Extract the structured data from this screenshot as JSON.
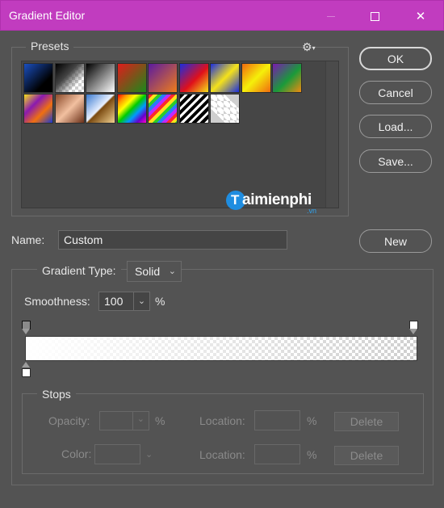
{
  "window": {
    "title": "Gradient Editor",
    "controls": {
      "minimize": "–",
      "maximize": "☐",
      "close": "✕"
    }
  },
  "presets": {
    "label": "Presets",
    "gear_icon": "⚙",
    "gear_caret": "▾",
    "swatches": [
      {
        "name": "foreground-to-background",
        "css": "linear-gradient(135deg,#1a4fbf 0%,#000 70%)"
      },
      {
        "name": "foreground-to-transparent",
        "css": "linear-gradient(135deg,#000 0%,#444 40%,transparent 75%)",
        "checker": true
      },
      {
        "name": "black-white",
        "css": "linear-gradient(135deg,#000 0%,#fff 100%)"
      },
      {
        "name": "red-green",
        "css": "linear-gradient(135deg,#e11b1b 0%,#1a8a1a 100%)"
      },
      {
        "name": "violet-orange",
        "css": "linear-gradient(135deg,#5a1aa0 0%,#ef7d1a 100%)"
      },
      {
        "name": "blue-red-yellow",
        "css": "linear-gradient(135deg,#1a2de0 0%,#e0101a 55%,#f5e21a 100%)"
      },
      {
        "name": "blue-yellow-blue",
        "css": "linear-gradient(135deg,#1a2de0 0%,#f5e21a 50%,#1a2de0 100%)"
      },
      {
        "name": "orange-yellow-orange",
        "css": "linear-gradient(135deg,#f06a0f 0%,#f5f00a 50%,#f06a0f 100%)"
      },
      {
        "name": "violet-green-orange",
        "css": "linear-gradient(135deg,#7a1ab0 0%,#1a9a3a 55%,#f08a10 100%)"
      },
      {
        "name": "yellow-violet-orange-blue",
        "css": "linear-gradient(135deg,#f5e21a 0%,#8a1ab0 35%,#f07010 65%,#1a3ad0 100%)"
      },
      {
        "name": "copper",
        "css": "linear-gradient(135deg,#8a4a2a 0%,#f2c0a0 50%,#6a3018 100%)"
      },
      {
        "name": "chrome",
        "css": "linear-gradient(135deg,#3a7ad0 0%,#e8f0ff 48%,#7a4a10 52%,#f0d090 100%)"
      },
      {
        "name": "spectrum",
        "css": "linear-gradient(135deg,#ff0000,#ff9900,#ffff00,#00cc00,#0099ff,#6600cc,#ff00cc)"
      },
      {
        "name": "transparent-rainbow",
        "css": "repeating-linear-gradient(135deg,#ff2a2a 0 4px,#ffe21a 4px 8px,#2acc2a 8px 12px,#2a7aff 12px 16px,#c02aff 16px 20px)",
        "checker": true
      },
      {
        "name": "transparent-stripes",
        "css": "repeating-linear-gradient(135deg,#000 0 4px,#fff 4px 7px)"
      },
      {
        "name": "transparent",
        "css": "transparent",
        "checker": true
      }
    ]
  },
  "watermark": {
    "brand": "aimienphi",
    "initial": "T",
    "suffix": ".vn"
  },
  "buttons": {
    "ok": "OK",
    "cancel": "Cancel",
    "load": "Load...",
    "save": "Save...",
    "new": "New"
  },
  "name": {
    "label": "Name:",
    "value": "Custom"
  },
  "gradient": {
    "type_label": "Gradient Type:",
    "type_value": "Solid",
    "smoothness_label": "Smoothness:",
    "smoothness_value": "100",
    "smoothness_unit": "%",
    "chevron": "⌄"
  },
  "stops": {
    "label": "Stops",
    "opacity_label": "Opacity:",
    "opacity_value": "",
    "opacity_unit": "%",
    "location_label": "Location:",
    "location_unit": "%",
    "delete_label": "Delete",
    "color_label": "Color:"
  },
  "colors": {
    "titlebar": "#c13cbf",
    "panel": "#535353",
    "text": "#e6e6e6"
  }
}
